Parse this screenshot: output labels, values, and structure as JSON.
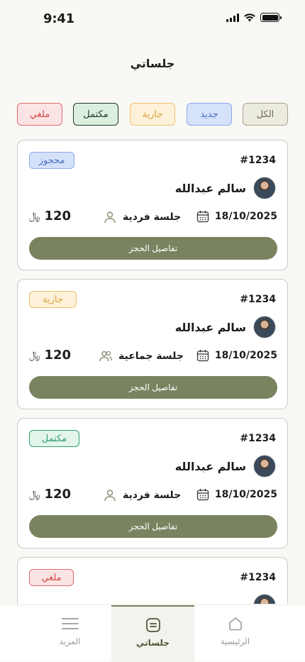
{
  "status_bar": {
    "time": "9:41"
  },
  "header": {
    "title": "جلساتي"
  },
  "filters": {
    "all": "الكل",
    "new": "جديد",
    "ongoing": "جارية",
    "completed": "مكتمل",
    "cancelled": "ملغي"
  },
  "cards": [
    {
      "status": "محجوز",
      "id": "#1234",
      "name": "سالم عبدالله",
      "date": "18/10/2025",
      "session_type": "جلسة فردية",
      "price": "120",
      "currency": "﷼",
      "button": "تفاصيل الحجز"
    },
    {
      "status": "جارية",
      "id": "#1234",
      "name": "سالم عبدالله",
      "date": "18/10/2025",
      "session_type": "جلسة جماعية",
      "price": "120",
      "currency": "﷼",
      "button": "تفاصيل الحجز"
    },
    {
      "status": "مكتمل",
      "id": "#1234",
      "name": "سالم عبدالله",
      "date": "18/10/2025",
      "session_type": "جلسة فردية",
      "price": "120",
      "currency": "﷼",
      "button": "تفاصيل الحجز"
    },
    {
      "status": "ملغي",
      "id": "#1234"
    }
  ],
  "nav": {
    "home": "الرئيسية",
    "sessions": "جلساتي",
    "more": "المزيد"
  }
}
